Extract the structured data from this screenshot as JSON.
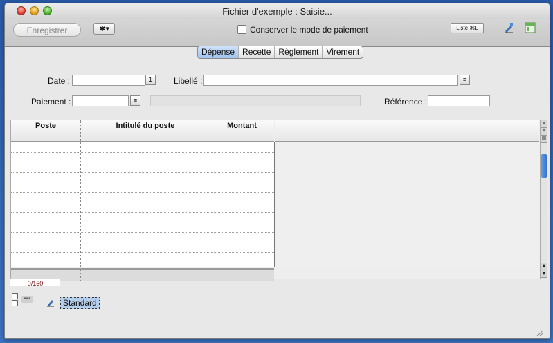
{
  "window": {
    "title": "Fichier d'exemple : Saisie..."
  },
  "toolbar": {
    "save_label": "Enregistrer",
    "gear_label": "✱▾",
    "keep_payment_mode_label": "Conserver le mode de paiement",
    "liste_label": "Liste ⌘L"
  },
  "tabs": [
    {
      "label": "Dépense",
      "selected": true
    },
    {
      "label": "Recette",
      "selected": false
    },
    {
      "label": "Règlement",
      "selected": false
    },
    {
      "label": "Virement",
      "selected": false
    }
  ],
  "form": {
    "date_label": "Date :",
    "date_value": "",
    "date_button": "1",
    "libelle_label": "Libellé :",
    "libelle_value": "",
    "paiement_label": "Paiement :",
    "paiement_value": "",
    "reference_label": "Référence :",
    "reference_value": ""
  },
  "table": {
    "columns": [
      "Poste",
      "Intitulé du poste",
      "Montant"
    ],
    "rows": []
  },
  "footer": {
    "count": "0/150",
    "standard_label": "Standard"
  },
  "colors": {
    "accent": "#9fc3ef",
    "count_text": "#7a1010"
  }
}
